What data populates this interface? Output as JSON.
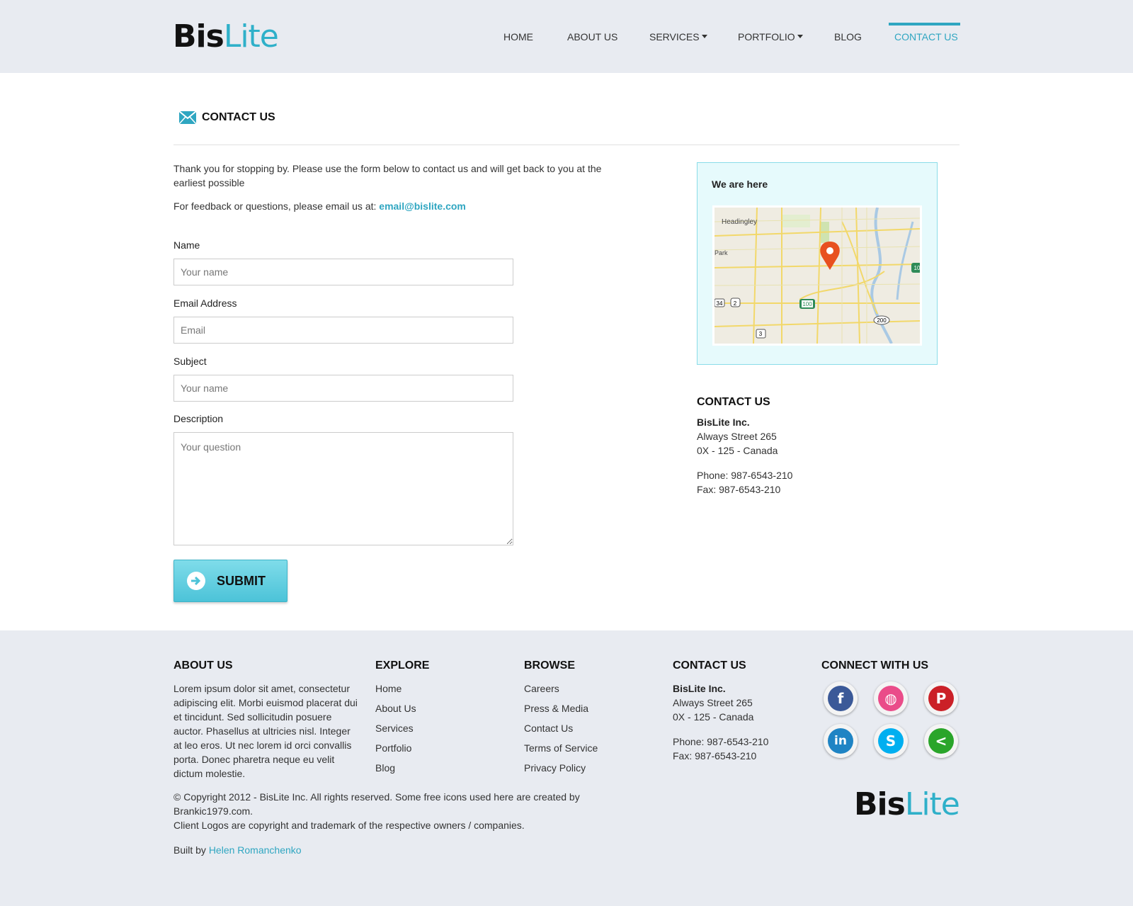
{
  "brand": {
    "bold": "Bis",
    "light": "Lite"
  },
  "nav": {
    "items": [
      {
        "label": "HOME"
      },
      {
        "label": "ABOUT US"
      },
      {
        "label": "SERVICES"
      },
      {
        "label": "PORTFOLIO"
      },
      {
        "label": "BLOG"
      },
      {
        "label": "CONTACT US"
      }
    ],
    "active": "CONTACT US"
  },
  "page": {
    "title": "CONTACT US"
  },
  "intro": "Thank you for stopping by. Please use the form below to contact us and will get back to you at the earliest possible",
  "feedback": {
    "prefix": "For feedback or questions, please email us at:",
    "email": "email@bislite.com"
  },
  "form": {
    "name": {
      "label": "Name",
      "placeholder": "Your name"
    },
    "email": {
      "label": "Email Address",
      "placeholder": "Email"
    },
    "subject": {
      "label": "Subject",
      "placeholder": "Your name"
    },
    "description": {
      "label": "Description",
      "placeholder": "Your question"
    },
    "submit": "SUBMIT"
  },
  "map": {
    "title": "We are here",
    "places": [
      "Headingley",
      "Park"
    ],
    "shields": [
      "34",
      "2",
      "100",
      "200",
      "3",
      "10"
    ]
  },
  "contact": {
    "title": "CONTACT US",
    "company": "BisLite Inc.",
    "street": "Always Street 265",
    "city": "0X - 125 - Canada",
    "phone": "Phone: 987-6543-210",
    "fax": "Fax: 987-6543-210"
  },
  "footer": {
    "about": {
      "title": "ABOUT US",
      "text": "Lorem ipsum dolor sit amet, consectetur adipiscing elit. Morbi euismod placerat dui et tincidunt. Sed sollicitudin posuere auctor. Phasellus at ultricies nisl. Integer at leo eros. Ut nec lorem id orci convallis porta. Donec pharetra neque eu velit dictum molestie."
    },
    "explore": {
      "title": "EXPLORE",
      "links": [
        "Home",
        "About Us",
        "Services",
        "Portfolio",
        "Blog"
      ]
    },
    "browse": {
      "title": "BROWSE",
      "links": [
        "Careers",
        "Press & Media",
        "Contact Us",
        "Terms of Service",
        "Privacy Policy"
      ]
    },
    "contact": {
      "title": "CONTACT US",
      "company": "BisLite Inc.",
      "street": "Always Street 265",
      "city": "0X - 125 - Canada",
      "phone": "Phone: 987-6543-210",
      "fax": "Fax: 987-6543-210"
    },
    "connect": {
      "title": "CONNECT WITH US",
      "networks": [
        {
          "name": "facebook",
          "glyph": "f",
          "color": "#3b5998"
        },
        {
          "name": "dribbble",
          "glyph": "◍",
          "color": "#ea4c89"
        },
        {
          "name": "pinterest",
          "glyph": "P",
          "color": "#cb2027"
        },
        {
          "name": "linkedin",
          "glyph": "in",
          "color": "#1f84c4"
        },
        {
          "name": "skype",
          "glyph": "S",
          "color": "#00aff0"
        },
        {
          "name": "share",
          "glyph": "<",
          "color": "#2aa52a"
        }
      ]
    },
    "copyright1": "© Copyright 2012 - BisLite Inc. All rights reserved. Some free icons used here are created by Brankic1979.com.",
    "copyright2": "Client Logos are copyright and trademark of the respective owners / companies.",
    "built_prefix": "Built by",
    "built_by": "Helen Romanchenko"
  }
}
